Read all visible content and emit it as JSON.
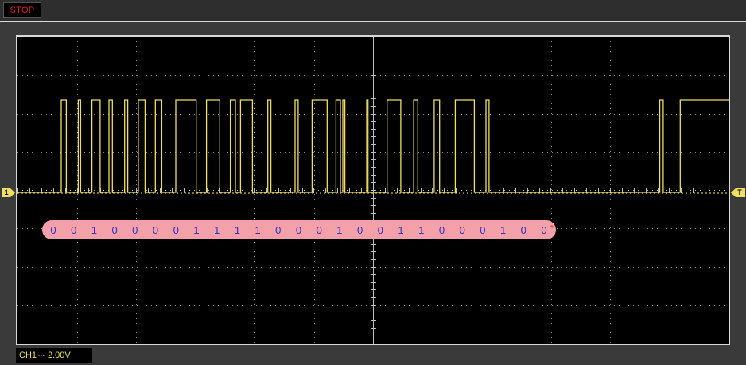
{
  "status": {
    "label": "STOP",
    "color": "#e02020"
  },
  "channel": {
    "label": "CH1",
    "coupling_icon": "dc-coupling-icon",
    "volts_per_div": "2.00V",
    "trace_color": "#f0e060",
    "marker_label": "1"
  },
  "trigger": {
    "marker_label": "T"
  },
  "decode": {
    "bits": [
      "0",
      "0",
      "1",
      "0",
      "0",
      "0",
      "0",
      "1",
      "1",
      "1",
      "1",
      "0",
      "0",
      "0",
      "1",
      "0",
      "0",
      "1",
      "1",
      "0",
      "0",
      "0",
      "1",
      "0",
      "0"
    ],
    "end_mark": "*",
    "bus_color": "#f4a0a8",
    "text_color": "#3030d0",
    "end_mark_color": "#e02020"
  },
  "waveform": {
    "pulses_us": [
      [
        0,
        1.5
      ],
      [
        5.0,
        5.7
      ],
      [
        9.0,
        11.4
      ],
      [
        14.0,
        15.0
      ],
      [
        18.6,
        19.5
      ],
      [
        22.6,
        24.6
      ],
      [
        27.6,
        29.5
      ],
      [
        33.6,
        39.6
      ],
      [
        42.6,
        46.5
      ],
      [
        49.6,
        51.1
      ],
      [
        52.6,
        56.1
      ],
      [
        60.6,
        61.5
      ],
      [
        68.6,
        69.5
      ],
      [
        73.6,
        78.0
      ],
      [
        80.6,
        81.9
      ],
      [
        82.6,
        83.2
      ],
      [
        89.6,
        90.0
      ],
      [
        95.6,
        99.6
      ],
      [
        103.4,
        104.6
      ],
      [
        109.4,
        111.0
      ],
      [
        115.6,
        121.2
      ],
      [
        124.6,
        125.5
      ],
      [
        175.6,
        176.6
      ],
      [
        181.6,
        196.0
      ]
    ],
    "time_range_us": [
      -3.5,
      196.0
    ]
  },
  "grid": {
    "h_divs": 12,
    "v_divs": 8,
    "dotted": true
  }
}
